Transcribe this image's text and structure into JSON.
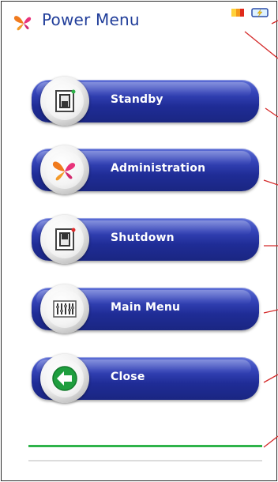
{
  "window": {
    "title": "Power Menu"
  },
  "status": {
    "battery_icon": "battery-icon",
    "power_icon": "power-plug-icon"
  },
  "menu": {
    "items": [
      {
        "label": "Standby",
        "icon": "standby-switch-icon"
      },
      {
        "label": "Administration",
        "icon": "butterfly-logo-icon"
      },
      {
        "label": "Shutdown",
        "icon": "shutdown-switch-icon"
      },
      {
        "label": "Main Menu",
        "icon": "equalizer-icon"
      },
      {
        "label": "Close",
        "icon": "back-arrow-icon"
      }
    ]
  },
  "colors": {
    "title": "#213e9a",
    "button": "#2a38a8",
    "accent_green": "#2fb34a",
    "callout_line": "#d42a2a",
    "logo_orange": "#f07a1e",
    "logo_pink": "#e8337a"
  }
}
